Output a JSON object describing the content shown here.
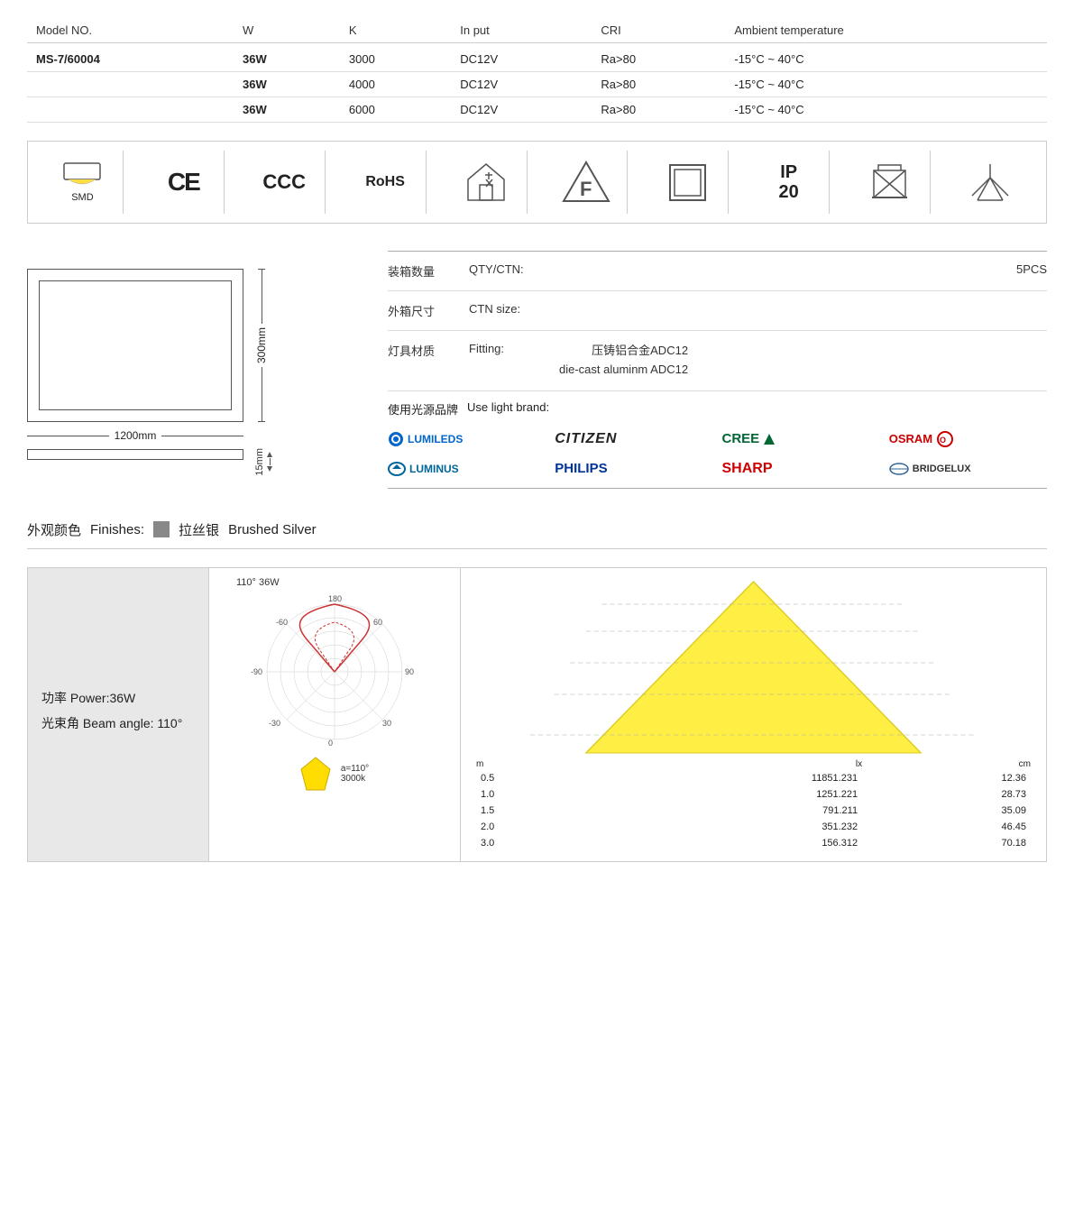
{
  "table": {
    "headers": [
      "Model NO.",
      "W",
      "K",
      "In put",
      "CRI",
      "Ambient temperature"
    ],
    "rows": [
      {
        "model": "MS-7/60004",
        "w": "36W",
        "k": "3000",
        "input": "DC12V",
        "cri": "Ra>80",
        "temp": "-15°C ~ 40°C"
      },
      {
        "model": "",
        "w": "36W",
        "k": "4000",
        "input": "DC12V",
        "cri": "Ra>80",
        "temp": "-15°C ~ 40°C"
      },
      {
        "model": "",
        "w": "36W",
        "k": "6000",
        "input": "DC12V",
        "cri": "Ra>80",
        "temp": "-15°C ~ 40°C"
      }
    ]
  },
  "certifications": [
    {
      "id": "smd",
      "label": "SMD"
    },
    {
      "id": "ce",
      "label": "CE"
    },
    {
      "id": "ccc",
      "label": "CCC"
    },
    {
      "id": "rohs",
      "label": "RoHS"
    },
    {
      "id": "house",
      "label": ""
    },
    {
      "id": "f-triangle",
      "label": ""
    },
    {
      "id": "square",
      "label": ""
    },
    {
      "id": "ip20",
      "label": "IP\n20"
    },
    {
      "id": "crossed-box",
      "label": ""
    },
    {
      "id": "beam",
      "label": ""
    }
  ],
  "dimensions": {
    "width": "1200mm",
    "height": "300mm",
    "depth": "15mm"
  },
  "product_info": {
    "qty_zh": "装箱数量",
    "qty_en": "QTY/CTN:",
    "qty_value": "5PCS",
    "ctn_zh": "外箱尺寸",
    "ctn_en": "CTN size:",
    "ctn_value": "",
    "fitting_zh": "灯具材质",
    "fitting_en": "Fitting:",
    "fitting_value_zh": "压铸铝合金ADC12",
    "fitting_value_en": "die-cast aluminm ADC12",
    "brand_zh": "使用光源品牌",
    "brand_en": "Use light brand:"
  },
  "brands": [
    {
      "id": "lumileds",
      "name": "LUMILEDS"
    },
    {
      "id": "citizen",
      "name": "CITIZEN"
    },
    {
      "id": "cree",
      "name": "CREE"
    },
    {
      "id": "osram",
      "name": "OSRAM"
    },
    {
      "id": "luminus",
      "name": "LUMINUS"
    },
    {
      "id": "philips",
      "name": "PHILIPS"
    },
    {
      "id": "sharp",
      "name": "SHARP"
    },
    {
      "id": "bridgelux",
      "name": "BRIDGELUX"
    }
  ],
  "finishes": {
    "label_zh": "外观颜色",
    "label_en": "Finishes:",
    "swatch_color": "#888888",
    "value_zh": "拉丝银",
    "value_en": "Brushed Silver"
  },
  "power": {
    "label1": "功率 Power:36W",
    "label2": "光束角 Beam angle: 110°"
  },
  "polar": {
    "title": "110°  36W",
    "angle": "a=110°",
    "kelvin": "3000k"
  },
  "photometric": {
    "header_lx": "lx",
    "header_cm": "cm",
    "rows": [
      {
        "m": "0.5",
        "lx": "11851.231",
        "cm": "12.36"
      },
      {
        "m": "1.0",
        "lx": "1251.221",
        "cm": "28.73"
      },
      {
        "m": "1.5",
        "lx": "791.211",
        "cm": "35.09"
      },
      {
        "m": "2.0",
        "lx": "351.232",
        "cm": "46.45"
      },
      {
        "m": "3.0",
        "lx": "156.312",
        "cm": "70.18"
      }
    ],
    "m_label": "m"
  }
}
